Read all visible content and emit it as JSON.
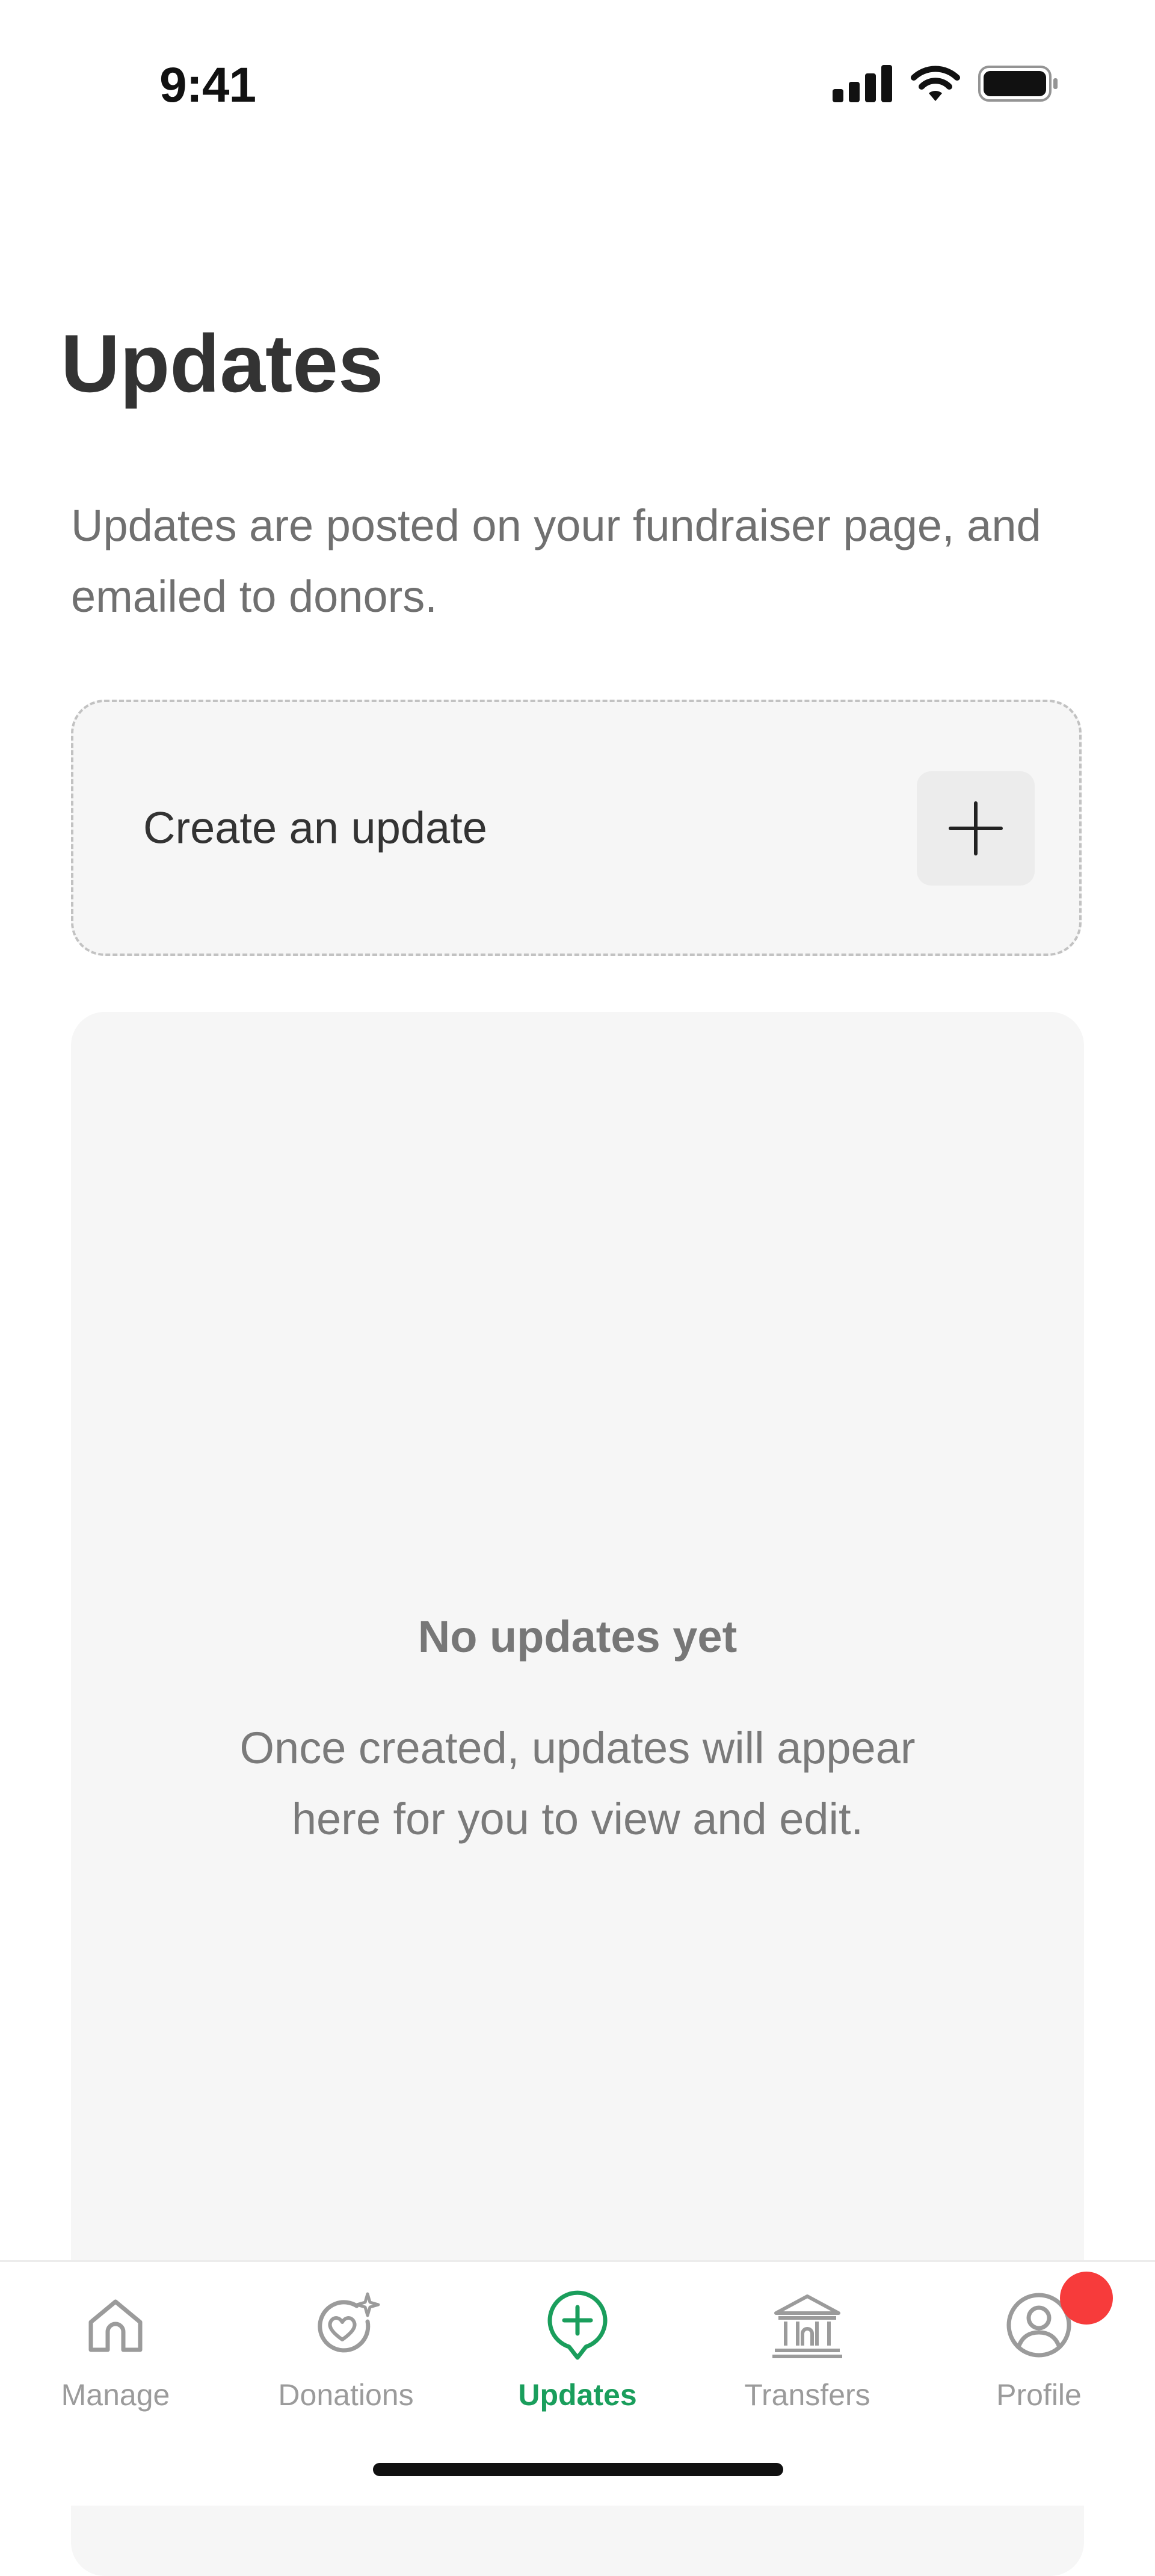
{
  "status_bar": {
    "time": "9:41"
  },
  "header": {
    "title": "Updates",
    "subtitle": "Updates are posted on your fundraiser page, and emailed to donors."
  },
  "create_card": {
    "label": "Create an update",
    "icon": "plus-icon"
  },
  "empty_state": {
    "title": "No updates yet",
    "body_line1": "Once created, updates will appear",
    "body_line2": "here for you to view and edit."
  },
  "tab_bar": {
    "active_color": "#1a9e5c",
    "inactive_color": "#9b9b9b",
    "items": [
      {
        "label": "Manage",
        "icon": "home-icon"
      },
      {
        "label": "Donations",
        "icon": "heart-sparkle-icon"
      },
      {
        "label": "Updates",
        "icon": "chat-plus-icon",
        "active": true
      },
      {
        "label": "Transfers",
        "icon": "bank-icon"
      },
      {
        "label": "Profile",
        "icon": "user-icon",
        "badge_color": "#f73b3b"
      }
    ]
  }
}
